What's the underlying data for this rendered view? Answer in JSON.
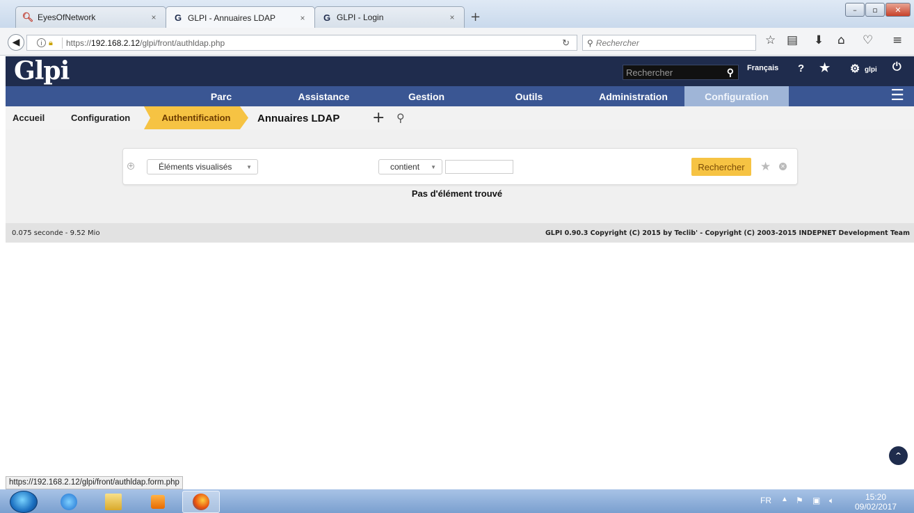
{
  "browser": {
    "tabs": [
      {
        "title": "EyesOfNetwork",
        "icon": "magnifier-favicon",
        "close": "×"
      },
      {
        "title": "GLPI - Annuaires LDAP",
        "icon": "glpi-favicon",
        "close": "×"
      },
      {
        "title": "GLPI - Login",
        "icon": "glpi-favicon",
        "close": "×"
      }
    ],
    "new_tab": "+",
    "window_controls": {
      "minimize": "–",
      "maximize": "▫",
      "close": "✕"
    },
    "url_prefix": "https://",
    "url_host": "192.168.2.12",
    "url_path": "/glpi/front/authldap.php",
    "search_placeholder": "Rechercher",
    "status_url": "https://192.168.2.12/glpi/front/authldap.form.php"
  },
  "glpi": {
    "logo": "Glpi",
    "search_placeholder": "Rechercher",
    "language": "Français",
    "help": "?",
    "user": "glpi",
    "menu": [
      {
        "label": "Parc"
      },
      {
        "label": "Assistance"
      },
      {
        "label": "Gestion"
      },
      {
        "label": "Outils"
      },
      {
        "label": "Administration"
      },
      {
        "label": "Configuration"
      }
    ],
    "breadcrumb": [
      "Accueil",
      "Configuration",
      "Authentification"
    ],
    "page_title": "Annuaires LDAP",
    "search": {
      "field": "Éléments visualisés",
      "operator": "contient",
      "value": "",
      "button": "Rechercher"
    },
    "no_result": "Pas d'élément trouvé",
    "footer_left": "0.075 seconde - 9.52 Mio",
    "footer_right": "GLPI 0.90.3 Copyright (C) 2015 by Teclib' - Copyright (C) 2003-2015 INDEPNET Development Team",
    "scroll_top": "^"
  },
  "taskbar": {
    "lang": "FR",
    "time": "15:20",
    "date": "09/02/2017"
  }
}
